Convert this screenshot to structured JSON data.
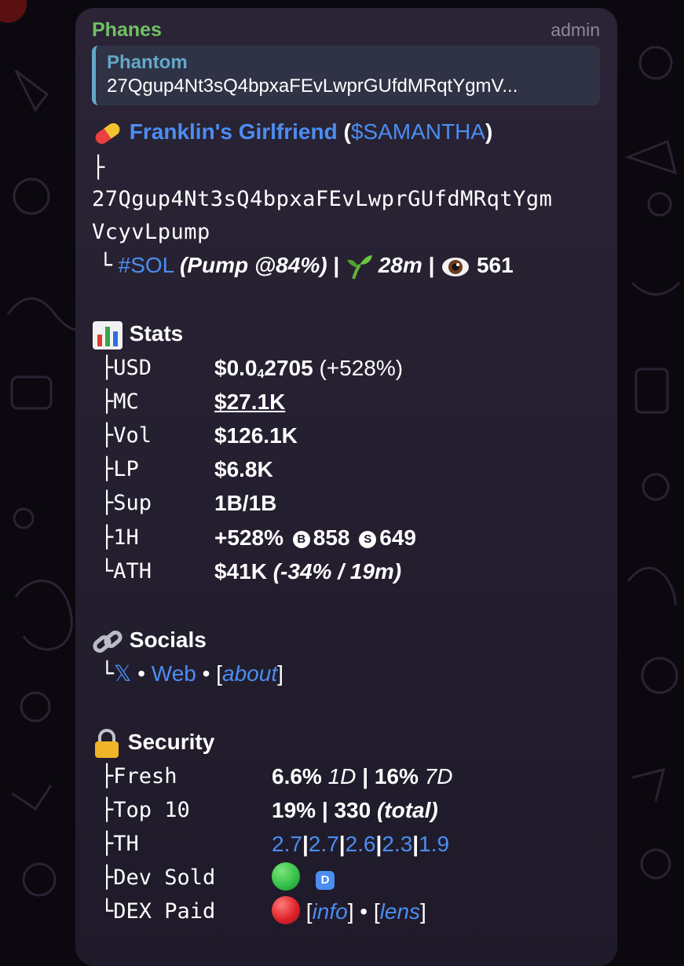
{
  "message": {
    "sender": "Phanes",
    "role": "admin",
    "reply": {
      "title": "Phantom",
      "text": "27Qgup4Nt3sQ4bpxaFEvLwprGUfdMRqtYgmV..."
    },
    "token": {
      "icon": "pill-icon",
      "name": "Franklin's Girlfriend",
      "paren_open": "(",
      "ticker": "$SAMANTHA",
      "paren_close": ")",
      "tree_branch": "├",
      "tree_end": "└",
      "address_line1": "27Qgup4Nt3sQ4bpxaFEvLwprGUfdMRqtYgm",
      "address_line2": "VcyvLpump",
      "chain": "#SOL",
      "pump_prefix": "(Pump @",
      "pump_pct": "84%",
      "pump_suffix": ")",
      "sep": "|",
      "age_icon": "seedling-icon",
      "age": "28m",
      "views_icon": "eye-icon",
      "views": "561"
    },
    "stats": {
      "icon": "bar-chart-icon",
      "title": "Stats",
      "usd_key": "USD",
      "usd_main": "$0.0",
      "usd_sub": "4",
      "usd_tail": "2705",
      "usd_change": "(+528%)",
      "mc_key": "MC",
      "mc_value": "$27.1K",
      "vol_key": "Vol",
      "vol_value": "$126.1K",
      "lp_key": "LP",
      "lp_value": "$6.8K",
      "sup_key": "Sup",
      "sup_value": "1B/1B",
      "h1_key": "1H",
      "h1_change": "+528%",
      "h1_buy_badge": "B",
      "h1_buys": "858",
      "h1_sell_badge": "S",
      "h1_sells": "649",
      "ath_key": "ATH",
      "ath_value": "$41K",
      "ath_detail": "(-34% / 19m)"
    },
    "socials": {
      "icon": "link-icon",
      "title": "Socials",
      "x_label": "𝕏",
      "bullet": "•",
      "web_label": "Web",
      "about_open": "[",
      "about_label": "about",
      "about_close": "]"
    },
    "security": {
      "icon": "lock-icon",
      "title": "Security",
      "fresh_key": "Fresh",
      "fresh_1d": "6.6%",
      "fresh_1d_label": "1D",
      "sep": "|",
      "fresh_7d": "16%",
      "fresh_7d_label": "7D",
      "top10_key": "Top 10",
      "top10_pct": "19%",
      "top10_total": "330",
      "top10_total_label": "(total)",
      "th_key": "TH",
      "th_values": [
        "2.7",
        "2.7",
        "2.6",
        "2.3",
        "1.9"
      ],
      "dev_key": "Dev Sold",
      "dev_status_color": "#35c24a",
      "dev_tag": "D",
      "dex_key": "DEX Paid",
      "dex_status_color": "#e0242c",
      "info_label": "info",
      "lens_label": "lens",
      "bracket_open": "[",
      "bracket_close": "]",
      "bullet": "•"
    }
  },
  "colors": {
    "link": "#4b8df2",
    "sender": "#72c164",
    "reply_accent": "#63a8c9",
    "bubble": "#2a2436",
    "background": "#0b090f"
  }
}
